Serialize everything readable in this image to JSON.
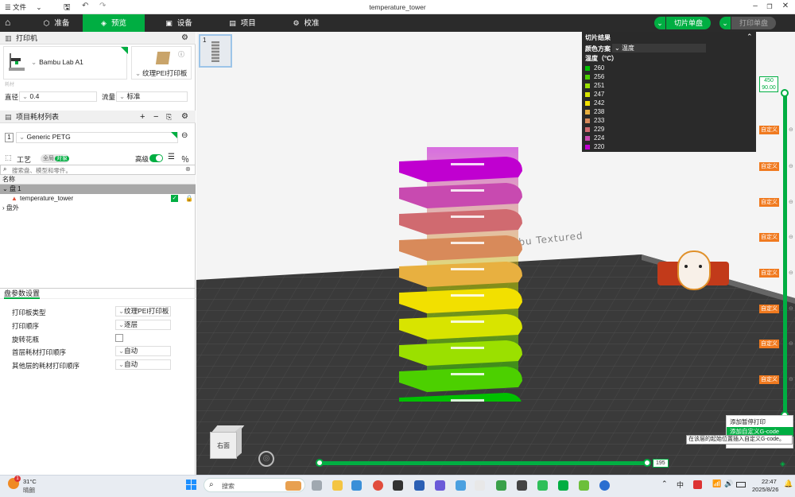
{
  "titlebar": {
    "menu_label": "文件",
    "title": "temperature_tower"
  },
  "nav": {
    "tabs": [
      "准备",
      "预览",
      "设备",
      "项目",
      "校准"
    ],
    "slice_btn": "切片单盘",
    "print_btn": "打印单盘"
  },
  "printer": {
    "section_title": "打印机",
    "name": "Bambu Lab A1",
    "plate_type": "纹理PEI打印板",
    "nozzle_label": "直径",
    "nozzle_value": "0.4",
    "flow_label": "流量",
    "flow_value": "标准",
    "sub_label": "耗材"
  },
  "filament": {
    "section_title": "项目耗材列表",
    "slot": "1",
    "name": "Generic PETG"
  },
  "process": {
    "section_title": "工艺",
    "toggle_global": "全局",
    "toggle_object": "对象",
    "advanced_label": "高级",
    "search_placeholder": "搜索盘、模型和零件。",
    "tree_header": "名称",
    "plate1": "盘 1",
    "object": "temperature_tower",
    "outside": "盘外"
  },
  "plate_settings": {
    "title": "盘参数设置",
    "rows": [
      {
        "label": "打印板类型",
        "value": "纹理PEI打印板"
      },
      {
        "label": "打印顺序",
        "value": "逐层"
      },
      {
        "label": "旋转花瓶",
        "value": ""
      },
      {
        "label": "首层耗材打印顺序",
        "value": "自动"
      },
      {
        "label": "其他层的耗材打印顺序",
        "value": "自动"
      }
    ]
  },
  "legend": {
    "title": "切片结果",
    "scheme_label": "颜色方案",
    "scheme_value": "温度",
    "unit_label": "温度（°C）",
    "items": [
      {
        "value": "260",
        "color": "#00c000"
      },
      {
        "value": "256",
        "color": "#4cd000"
      },
      {
        "value": "251",
        "color": "#9be000"
      },
      {
        "value": "247",
        "color": "#d8e400"
      },
      {
        "value": "242",
        "color": "#f2e000"
      },
      {
        "value": "238",
        "color": "#e8b040"
      },
      {
        "value": "233",
        "color": "#d88a5a"
      },
      {
        "value": "229",
        "color": "#d06a70"
      },
      {
        "value": "224",
        "color": "#c84ab0"
      },
      {
        "value": "220",
        "color": "#c000d0"
      }
    ]
  },
  "layer_slider": {
    "layer_top": "450",
    "height_top": "90.00",
    "custom_label": "自定义"
  },
  "horizontal_slider": {
    "value": "195"
  },
  "viewcube": {
    "face_label": "右面"
  },
  "context_menu": {
    "items": [
      "添加暂停打印",
      "添加自定义G-code"
    ],
    "tooltip": "在该层的起始位置插入自定义G-code。"
  },
  "plate_thumb": {
    "number": "1"
  },
  "bed_text": "Bambu Textured",
  "taskbar": {
    "temperature": "31°C",
    "weather": "晴朗",
    "badge": "1",
    "search_placeholder": "搜索",
    "ime": "中",
    "time": "22:47",
    "date": "2025/8/26"
  }
}
